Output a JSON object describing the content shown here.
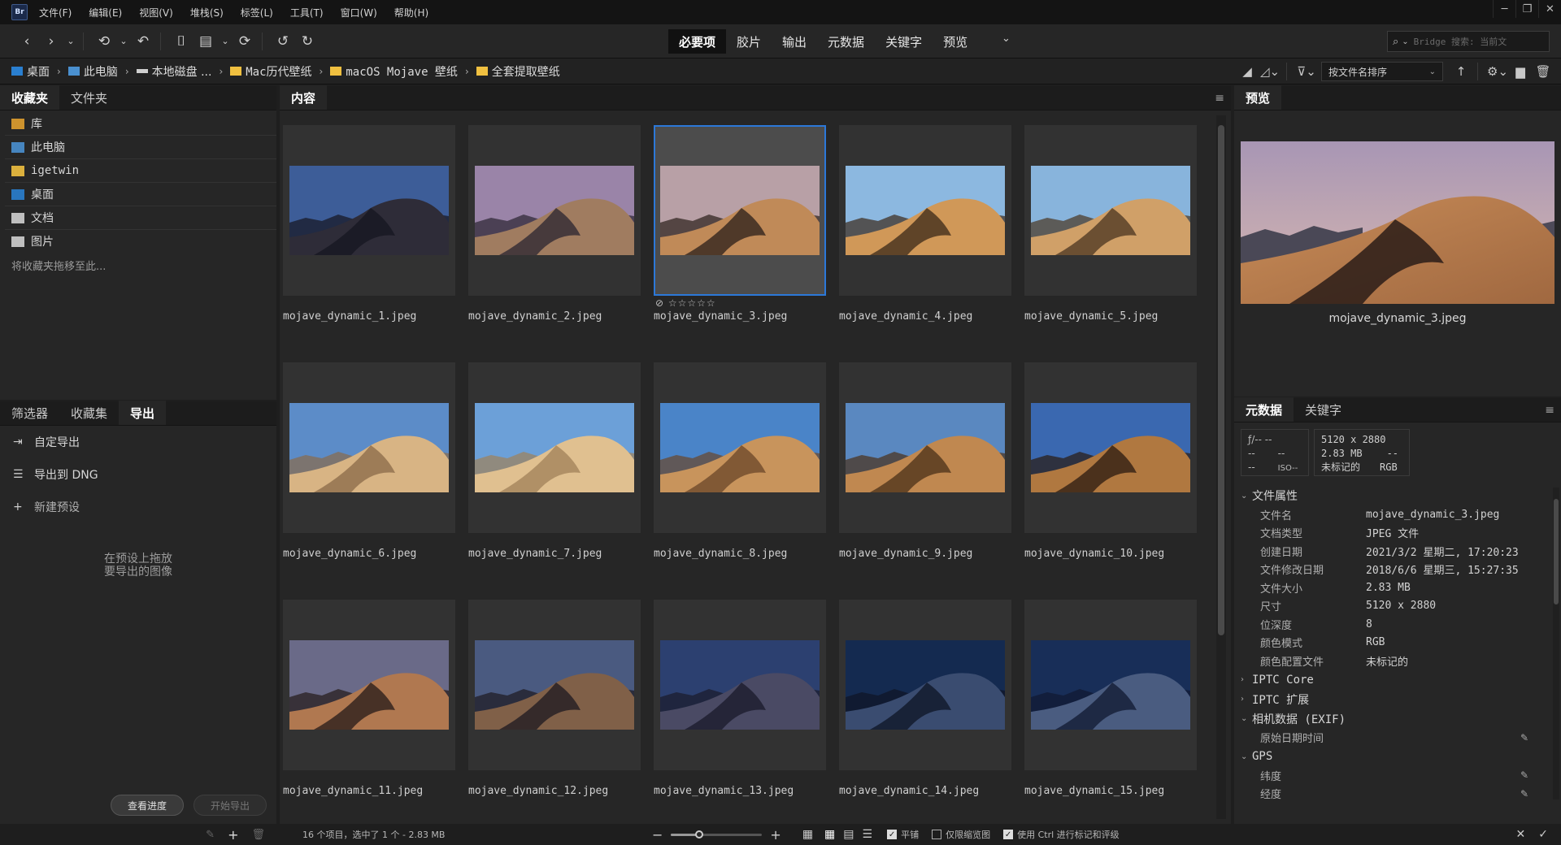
{
  "app": {
    "logo": "Br"
  },
  "menu": [
    "文件(F)",
    "编辑(E)",
    "视图(V)",
    "堆栈(S)",
    "标签(L)",
    "工具(T)",
    "窗口(W)",
    "帮助(H)"
  ],
  "workspaces": [
    {
      "label": "必要项",
      "active": true
    },
    {
      "label": "胶片",
      "active": false
    },
    {
      "label": "输出",
      "active": false
    },
    {
      "label": "元数据",
      "active": false
    },
    {
      "label": "关键字",
      "active": false
    },
    {
      "label": "预览",
      "active": false
    }
  ],
  "search": {
    "placeholder": "Bridge 搜索: 当前文"
  },
  "breadcrumb": [
    {
      "label": "桌面",
      "icon": "desktop-icon"
    },
    {
      "label": "此电脑",
      "icon": "computer-icon"
    },
    {
      "label": "本地磁盘 ...",
      "icon": "drive-icon"
    },
    {
      "label": "Mac历代壁纸",
      "icon": "folder-icon"
    },
    {
      "label": "macOS Mojave 壁纸",
      "icon": "folder-icon"
    },
    {
      "label": "全套提取壁纸",
      "icon": "folder-icon"
    }
  ],
  "sort": {
    "label": "按文件名排序"
  },
  "left_top": {
    "tabs": [
      "收藏夹",
      "文件夹"
    ],
    "favorites": [
      {
        "label": "库",
        "color": "#e0a030"
      },
      {
        "label": "此电脑",
        "color": "#4a90d0"
      },
      {
        "label": "igetwin",
        "color": "#f0c040"
      },
      {
        "label": "桌面",
        "color": "#2a7fd0"
      },
      {
        "label": "文档",
        "color": "#d0d0d0"
      },
      {
        "label": "图片",
        "color": "#d0d0d0"
      }
    ],
    "hint": "将收藏夹拖移至此..."
  },
  "left_bottom": {
    "tabs": [
      "筛选器",
      "收藏集",
      "导出"
    ],
    "items": [
      {
        "label": "自定导出",
        "icon": "export-icon"
      },
      {
        "label": "导出到 DNG",
        "icon": "list-icon"
      },
      {
        "label": "新建预设",
        "icon": "plus-icon"
      }
    ],
    "drop_hint_line1": "在预设上拖放",
    "drop_hint_line2": "要导出的图像",
    "view_progress": "查看进度",
    "start_export": "开始导出"
  },
  "content": {
    "tab": "内容",
    "rating_stars": "☆☆☆☆☆",
    "items": [
      {
        "name": "mojave_dynamic_1.jpeg",
        "sky": "#3d5d98",
        "sand": "#2e2c38",
        "shadow": "#161620"
      },
      {
        "name": "mojave_dynamic_2.jpeg",
        "sky": "#9a84a8",
        "sand": "#a07c60",
        "shadow": "#2a2430"
      },
      {
        "name": "mojave_dynamic_3.jpeg",
        "sky": "#b8a0a6",
        "sand": "#c08a58",
        "shadow": "#2a1e1a",
        "selected": true
      },
      {
        "name": "mojave_dynamic_4.jpeg",
        "sky": "#8cb8e0",
        "sand": "#d09858",
        "shadow": "#3a2818"
      },
      {
        "name": "mojave_dynamic_5.jpeg",
        "sky": "#88b4dc",
        "sand": "#d0a068",
        "shadow": "#4a3420"
      },
      {
        "name": "mojave_dynamic_6.jpeg",
        "sky": "#5c8cc8",
        "sand": "#d8b484",
        "shadow": "#8a6a48"
      },
      {
        "name": "mojave_dynamic_7.jpeg",
        "sky": "#6ca0d8",
        "sand": "#e0c090",
        "shadow": "#a08058"
      },
      {
        "name": "mojave_dynamic_8.jpeg",
        "sky": "#4a84c8",
        "sand": "#c8945c",
        "shadow": "#6a4628"
      },
      {
        "name": "mojave_dynamic_9.jpeg",
        "sky": "#5a88c0",
        "sand": "#c08850",
        "shadow": "#4a3018"
      },
      {
        "name": "mojave_dynamic_10.jpeg",
        "sky": "#3a68b0",
        "sand": "#b07840",
        "shadow": "#2a1a10"
      },
      {
        "name": "mojave_dynamic_11.jpeg",
        "sky": "#6a6a88",
        "sand": "#b07850",
        "shadow": "#241a18"
      },
      {
        "name": "mojave_dynamic_12.jpeg",
        "sky": "#4a5a80",
        "sand": "#806048",
        "shadow": "#1c1820"
      },
      {
        "name": "mojave_dynamic_13.jpeg",
        "sky": "#2c4070",
        "sand": "#4a4a64",
        "shadow": "#1a1a2a"
      },
      {
        "name": "mojave_dynamic_14.jpeg",
        "sky": "#142a50",
        "sand": "#3a4c70",
        "shadow": "#0e1424"
      },
      {
        "name": "mojave_dynamic_15.jpeg",
        "sky": "#182e58",
        "sand": "#4a5c80",
        "shadow": "#101830"
      }
    ]
  },
  "status": {
    "summary": "16 个项目，选中了 1 个 - 2.83 MB",
    "smooth_label": "平铺",
    "thumbs_only_label": "仅限缩览图",
    "ctrl_label": "使用 Ctrl 进行标记和评级"
  },
  "preview": {
    "tab": "预览",
    "filename": "mojave_dynamic_3.jpeg"
  },
  "metadata": {
    "tabs": [
      "元数据",
      "关键字"
    ],
    "camera": {
      "f": "ƒ/-- --",
      "a": "--",
      "b": "--",
      "c": "--",
      "iso": "ISO--"
    },
    "summary": {
      "dims": "5120 x 2880",
      "size": "2.83 MB",
      "dash": "--",
      "profile": "未标记的",
      "mode": "RGB"
    },
    "file_props_title": "文件属性",
    "file_props": [
      {
        "label": "文件名",
        "value": "mojave_dynamic_3.jpeg"
      },
      {
        "label": "文档类型",
        "value": "JPEG 文件"
      },
      {
        "label": "创建日期",
        "value": "2021/3/2 星期二, 17:20:23"
      },
      {
        "label": "文件修改日期",
        "value": "2018/6/6 星期三, 15:27:35"
      },
      {
        "label": "文件大小",
        "value": "2.83 MB"
      },
      {
        "label": "尺寸",
        "value": "5120 x 2880"
      },
      {
        "label": "位深度",
        "value": "8"
      },
      {
        "label": "颜色模式",
        "value": "RGB"
      },
      {
        "label": "颜色配置文件",
        "value": "未标记的"
      }
    ],
    "iptc_core": "IPTC Core",
    "iptc_ext": "IPTC 扩展",
    "exif": "相机数据 (EXIF)",
    "exif_field": "原始日期时间",
    "gps": "GPS",
    "gps_lat": "纬度",
    "gps_lon": "经度"
  }
}
